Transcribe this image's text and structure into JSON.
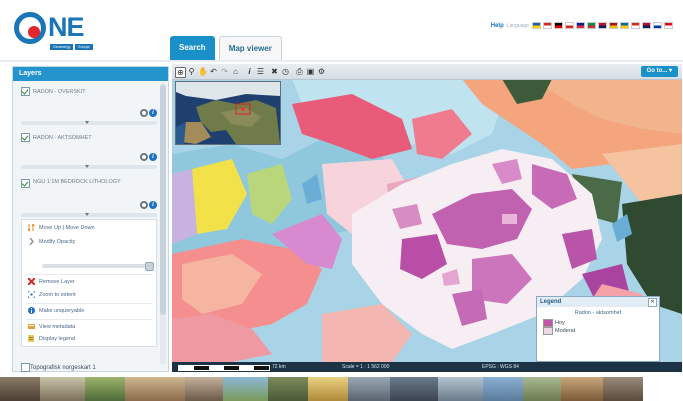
{
  "app": {
    "logo_text": "NE",
    "logo_sub": [
      "Geoenergy",
      "Europe"
    ],
    "help_label": "Help",
    "language_label": "Language",
    "flag_colors": [
      [
        "#1e5ba8",
        "#ffd400"
      ],
      [
        "#d52b1e",
        "#ffffff"
      ],
      [
        "#000000",
        "#dd0000"
      ],
      [
        "#ffffff",
        "#d52b1e"
      ],
      [
        "#002395",
        "#ed2939"
      ],
      [
        "#009246",
        "#ce2b37"
      ],
      [
        "#c8102e",
        "#012169"
      ],
      [
        "#aa151b",
        "#f1bf00"
      ],
      [
        "#006aa7",
        "#fecc00"
      ],
      [
        "#d52b1e",
        "#ffffff"
      ],
      [
        "#ba0c2f",
        "#00205b"
      ],
      [
        "#ffffff",
        "#0039a6"
      ],
      [
        "#e30a17",
        "#ffffff"
      ]
    ]
  },
  "tabs": {
    "search": "Search",
    "viewer": "Map viewer"
  },
  "layers_panel": {
    "title": "Layers",
    "layers": [
      {
        "name": "Radon - overskit",
        "checked": true
      },
      {
        "name": "Radon - aktsomhet",
        "checked": true
      },
      {
        "name": "NGU 1:1M BEDROCK LITHOLOGY",
        "checked": true
      }
    ],
    "actions": [
      {
        "label": "Move Up | Move Down",
        "icon": "move-icon",
        "color": "#f08a1c"
      },
      {
        "label": "Modify Opacity",
        "icon": "opacity-icon",
        "color": "#8c96a0"
      },
      {
        "label": "Remove Layer",
        "icon": "remove-icon",
        "color": "#d0281e"
      },
      {
        "label": "Zoom to extent",
        "icon": "zoom-extent-icon",
        "color": "#2a80c8"
      },
      {
        "label": "Make unqueryable",
        "icon": "info-icon",
        "color": "#1a72c0"
      },
      {
        "label": "View metadata",
        "icon": "metadata-icon",
        "color": "#e8a13a"
      },
      {
        "label": "Display legend",
        "icon": "legend-icon",
        "color": "#e8c85a"
      }
    ],
    "extra_layer": {
      "name": "Topografisk norgeskart 1",
      "checked": false
    }
  },
  "toolbar": {
    "icons": [
      "zoom-box-icon",
      "zoom-icon",
      "pan-icon",
      "undo-icon",
      "redo-icon",
      "home-icon",
      "info-icon",
      "list-icon",
      "tools-icon",
      "clock-icon",
      "print-icon",
      "save-icon",
      "settings-icon"
    ],
    "goto_label": "Go to..."
  },
  "statusbar": {
    "scale_distance": "72 km",
    "scale_label": "Scale = 1 : 1 562 000",
    "coords": "EPSG : WGS 84"
  },
  "legend": {
    "title": "Legend",
    "subtitle": "Radon - aktsomhet",
    "items": [
      {
        "label": "Hoy",
        "color": "#c255a8"
      },
      {
        "label": "Moderat",
        "color": "#f0d8e6"
      }
    ]
  }
}
